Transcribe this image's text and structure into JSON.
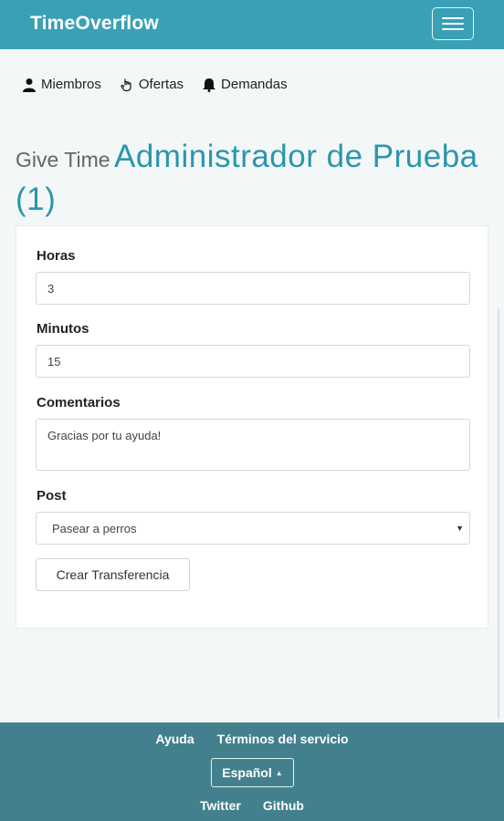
{
  "navbar": {
    "brand": "TimeOverflow",
    "menu_icon": "hamburger-menu-icon"
  },
  "subnav": [
    {
      "label": "Miembros",
      "icon": "user-icon"
    },
    {
      "label": "Ofertas",
      "icon": "hand-pointer-icon"
    },
    {
      "label": "Demandas",
      "icon": "bell-icon"
    }
  ],
  "title": {
    "prefix": "Give Time",
    "name": "Administrador de Prueba (1)"
  },
  "form": {
    "hours_label": "Horas",
    "hours_value": "3",
    "minutes_label": "Minutos",
    "minutes_value": "15",
    "comments_label": "Comentarios",
    "comments_value": "Gracias por tu ayuda!",
    "post_label": "Post",
    "post_value": "Pasear a perros",
    "submit_label": "Crear Transferencia"
  },
  "footer": {
    "help": "Ayuda",
    "terms": "Términos del servicio",
    "language": "Español",
    "twitter": "Twitter",
    "github": "Github"
  },
  "colors": {
    "navbar": "#3aa0b5",
    "title_accent": "#2a96ad",
    "footer": "#43808d"
  }
}
